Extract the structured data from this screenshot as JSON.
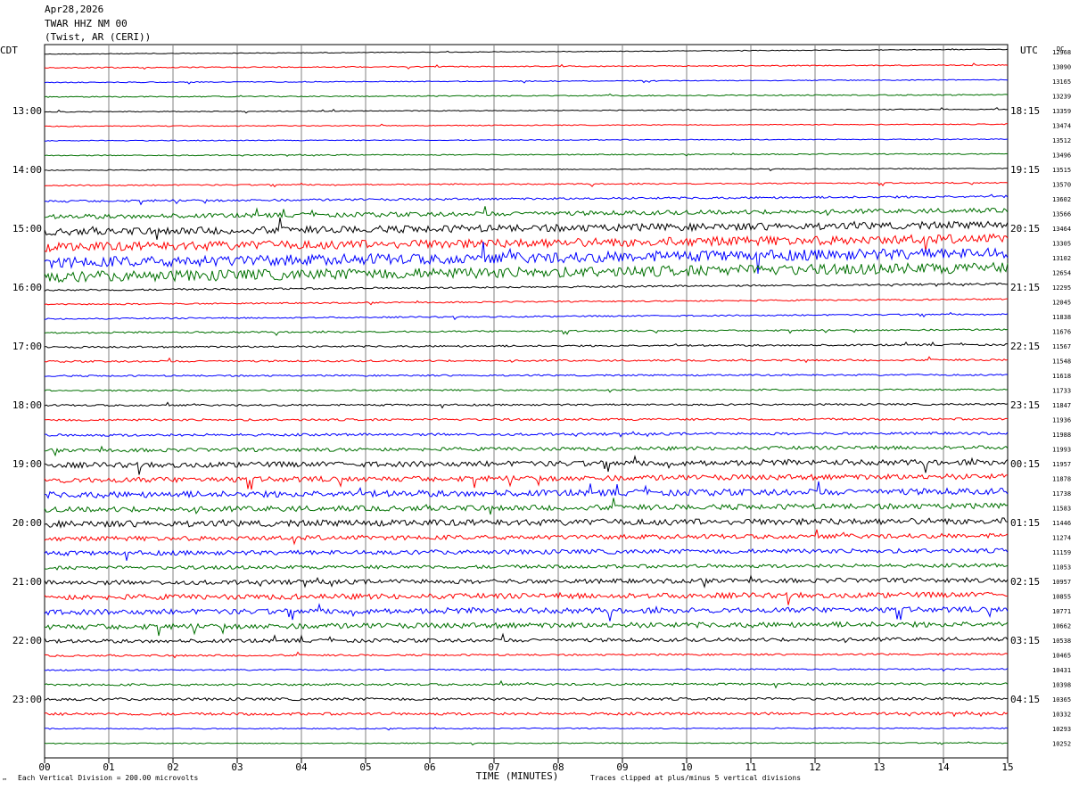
{
  "header": {
    "date": "Apr28,2026",
    "station": "TWAR HHZ NM 00",
    "location": "(Twist, AR (CERI))"
  },
  "left_axis_label": "CDT",
  "right_axis_label": "UTC",
  "dc_label": "DC",
  "footer": {
    "scale": "Each Vertical Division =  200.00 microvolts",
    "clip": "Traces clipped at plus/minus 5 vertical divisions",
    "corner_mark": "™"
  },
  "colors": {
    "cycle": [
      "#000000",
      "#ff0000",
      "#0000ff",
      "#007000"
    ],
    "grid": "#808080"
  },
  "chart_data": {
    "type": "line",
    "title": "",
    "xlabel": "TIME (MINUTES)",
    "xlim": [
      0,
      15
    ],
    "x_ticks": [
      "00",
      "01",
      "02",
      "03",
      "04",
      "05",
      "06",
      "07",
      "08",
      "09",
      "10",
      "11",
      "12",
      "13",
      "14",
      "15"
    ],
    "grid": true,
    "trace_minutes_each": 15,
    "left_hour_labels": [
      {
        "row": 4,
        "text": "13:00"
      },
      {
        "row": 8,
        "text": "14:00"
      },
      {
        "row": 12,
        "text": "15:00"
      },
      {
        "row": 16,
        "text": "16:00"
      },
      {
        "row": 20,
        "text": "17:00"
      },
      {
        "row": 24,
        "text": "18:00"
      },
      {
        "row": 28,
        "text": "19:00"
      },
      {
        "row": 32,
        "text": "20:00"
      },
      {
        "row": 36,
        "text": "21:00"
      },
      {
        "row": 40,
        "text": "22:00"
      },
      {
        "row": 44,
        "text": "23:00"
      }
    ],
    "right_hour_labels": [
      {
        "row": 4,
        "text": "18:15"
      },
      {
        "row": 8,
        "text": "19:15"
      },
      {
        "row": 12,
        "text": "20:15"
      },
      {
        "row": 16,
        "text": "21:15"
      },
      {
        "row": 20,
        "text": "22:15"
      },
      {
        "row": 24,
        "text": "23:15"
      },
      {
        "row": 28,
        "text": "00:15"
      },
      {
        "row": 32,
        "text": "01:15"
      },
      {
        "row": 36,
        "text": "02:15"
      },
      {
        "row": 40,
        "text": "03:15"
      },
      {
        "row": 44,
        "text": "04:15"
      }
    ],
    "dc_offsets": [
      "12968",
      "13090",
      "13165",
      "13239",
      "13359",
      "13474",
      "13512",
      "13496",
      "13515",
      "13570",
      "13602",
      "13566",
      "13464",
      "13305",
      "13102",
      "12654",
      "12295",
      "12045",
      "11838",
      "11676",
      "11567",
      "11548",
      "11618",
      "11733",
      "11847",
      "11936",
      "11988",
      "11993",
      "11957",
      "11878",
      "11738",
      "11583",
      "11446",
      "11274",
      "11159",
      "11053",
      "10957",
      "10855",
      "10771",
      "10662",
      "10538",
      "10465",
      "10431",
      "10398",
      "10365",
      "10332",
      "10293",
      "10252"
    ],
    "trace_amplitude": [
      0.4,
      0.6,
      0.5,
      0.6,
      0.5,
      0.5,
      0.5,
      0.6,
      0.5,
      0.7,
      1.2,
      2.5,
      4,
      5,
      6,
      6,
      1,
      0.8,
      0.8,
      0.9,
      1,
      1,
      0.9,
      0.9,
      1,
      1.2,
      1.4,
      2,
      3,
      3,
      3.5,
      3,
      3.5,
      2.5,
      2.5,
      2,
      2.5,
      3,
      3,
      3,
      2,
      1,
      0.8,
      1.2,
      1.5,
      1.5,
      0.6,
      0.5
    ],
    "trace_slope": [
      -0.9,
      -0.5,
      -0.5,
      -0.4,
      -0.5,
      -0.4,
      -0.3,
      -0.3,
      -0.3,
      -0.5,
      -0.9,
      -1.2,
      -1.3,
      -1.6,
      -1.8,
      -1.7,
      -1.2,
      -1.0,
      -0.9,
      -0.6,
      -0.5,
      -0.3,
      -0.2,
      -0.2,
      -0.2,
      -0.2,
      -0.4,
      -0.6,
      -0.6,
      -0.7,
      -0.7,
      -0.7,
      -0.6,
      -0.6,
      -0.5,
      -0.5,
      -0.5,
      -0.5,
      -0.5,
      -0.5,
      -0.4,
      -0.3,
      -0.2,
      -0.2,
      -0.1,
      -0.1,
      -0.1,
      -0.1
    ]
  }
}
